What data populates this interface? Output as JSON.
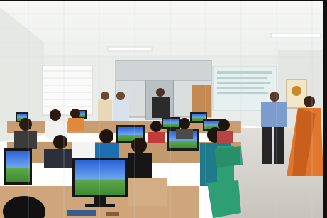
{
  "scene": {
    "kind": "photograph",
    "subject": "computer-lab-training-session",
    "colors": {
      "ceiling": "#f3f4f2",
      "wall": "#e9ece9",
      "floor": "#d8d4cf",
      "desk": "#c9a27a",
      "chair_green": "#2e9e74",
      "monitor_bezel": "#1c1c1c",
      "monitor_screen": "#3b7be0",
      "projection": "#e6f0ef",
      "saree": "#e0772b",
      "grid_overlay": "#cfd6e6"
    }
  }
}
